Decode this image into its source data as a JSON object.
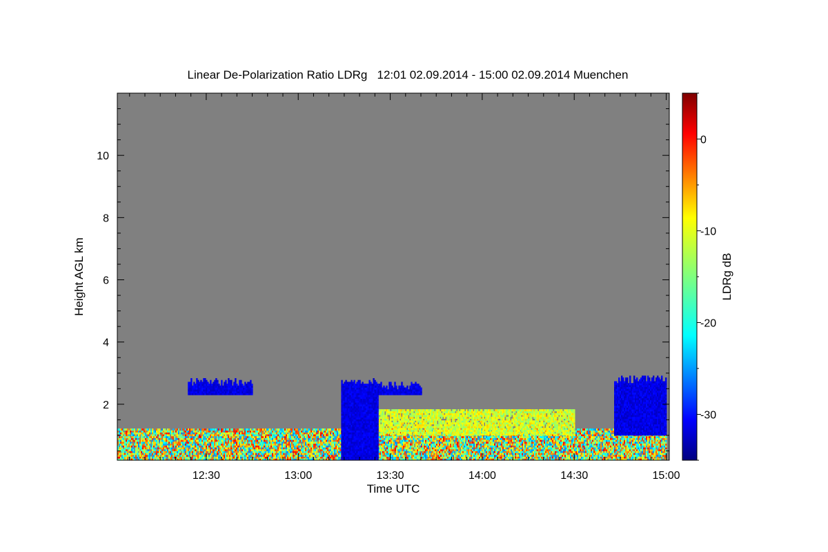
{
  "chart_data": {
    "type": "heatmap",
    "title": "Linear De-Polarization Ratio LDRg   12:01 02.09.2014 - 15:00 02.09.2014 Muenchen",
    "xlabel": "Time UTC",
    "ylabel": "Height AGL km",
    "colorbar_label": "LDRg dB",
    "x_ticks": [
      "12:30",
      "13:00",
      "13:30",
      "14:00",
      "14:30",
      "15:00"
    ],
    "x_tick_values_min": [
      750,
      780,
      810,
      840,
      870,
      900
    ],
    "xlim_min": [
      721,
      901
    ],
    "y_ticks": [
      2,
      4,
      6,
      8,
      10
    ],
    "ylim_km": [
      0.2,
      12.0
    ],
    "colorbar_ticks": [
      0,
      -10,
      -20,
      -30
    ],
    "colorbar_range_db": [
      -35,
      5
    ],
    "colormap": [
      "#00007f",
      "#0000ff",
      "#007fff",
      "#00ffff",
      "#7fff7f",
      "#ffff00",
      "#ff7f00",
      "#ff0000",
      "#7f0000"
    ],
    "no_signal_color": "#808080",
    "features": [
      {
        "name": "aerosol boundary layer",
        "x_range": [
          "12:01",
          "15:00"
        ],
        "y_range_km": [
          0.2,
          1.2
        ],
        "ldr_db_range": [
          -25,
          0
        ]
      },
      {
        "name": "elevated aerosol layer",
        "x_range": [
          "13:20",
          "14:30"
        ],
        "y_range_km": [
          1.0,
          1.8
        ],
        "ldr_db_range": [
          -15,
          -8
        ]
      },
      {
        "name": "cloud layer",
        "x_range": [
          "12:24",
          "12:45"
        ],
        "y_range_km": [
          2.3,
          2.8
        ],
        "ldr_db": -31
      },
      {
        "name": "cloud / precipitation column",
        "x_range": [
          "13:14",
          "13:26"
        ],
        "y_range_km": [
          0.2,
          2.8
        ],
        "ldr_db": -31
      },
      {
        "name": "cloud layer",
        "x_range": [
          "13:25",
          "13:40"
        ],
        "y_range_km": [
          2.3,
          2.7
        ],
        "ldr_db": -31
      },
      {
        "name": "cloud layer",
        "x_range": [
          "14:43",
          "15:00"
        ],
        "y_range_km": [
          1.0,
          2.9
        ],
        "ldr_db": -31
      }
    ]
  }
}
